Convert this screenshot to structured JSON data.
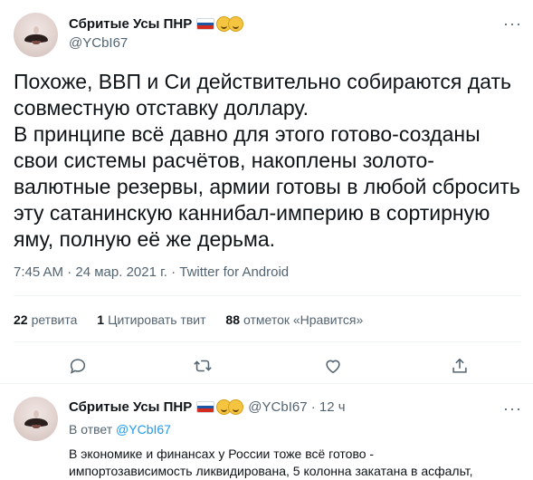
{
  "main_tweet": {
    "display_name": "Сбритые Усы ПНР",
    "handle": "@YCbI67",
    "more_icon": "more-horizontal-icon",
    "body": "Похоже, ВВП и Си действительно собираются дать совместную отставку доллару.\nВ принципе всё давно для этого готово-созданы свои системы расчётов, накоплены золото-валютные резервы, армии готовы в любой сбросить эту сатанинскую каннибал-империю в сортирную яму, полную её же дерьма.",
    "time": "7:45 AM",
    "date": "24 мар. 2021 г.",
    "source": "Twitter for Android",
    "stats": {
      "retweets_count": "22",
      "retweets_label": "ретвита",
      "quotes_count": "1",
      "quotes_label": "Цитировать твит",
      "likes_count": "88",
      "likes_label": "отметок «Нравится»"
    },
    "actions": [
      "reply-icon",
      "retweet-icon",
      "like-icon",
      "share-icon"
    ]
  },
  "reply_tweet": {
    "display_name": "Сбритые Усы ПНР",
    "handle": "@YCbI67",
    "time_ago": "12 ч",
    "reply_prefix": "В ответ",
    "reply_handle": "@YCbI67",
    "body": "В экономике и финансах у России тоже всё готово -\nимпортозависимость ликвидирована, 5 колонна закатана в асфальт,"
  },
  "colors": {
    "text": "#0f1419",
    "secondary": "#536471",
    "link": "#1d9bf0",
    "divider": "#eff3f4"
  }
}
